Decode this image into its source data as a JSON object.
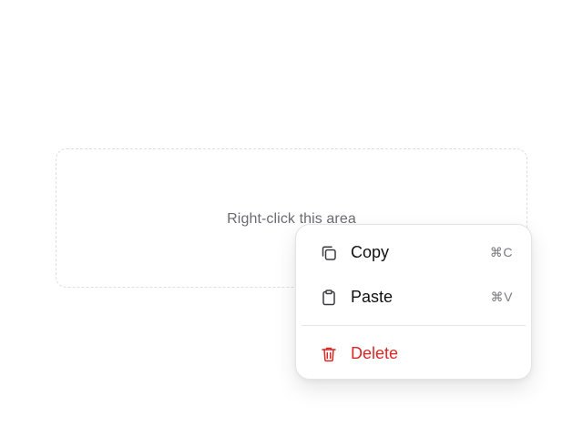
{
  "area": {
    "label": "Right-click this area"
  },
  "context_menu": {
    "items": [
      {
        "label": "Copy",
        "shortcut": "⌘C",
        "icon": "copy-icon"
      },
      {
        "label": "Paste",
        "shortcut": "⌘V",
        "icon": "clipboard-icon"
      }
    ],
    "danger_item": {
      "label": "Delete",
      "icon": "trash-icon"
    }
  },
  "colors": {
    "danger": "#dc2626",
    "text": "#111113",
    "muted": "#6b6b70",
    "border": "#dedee2"
  }
}
